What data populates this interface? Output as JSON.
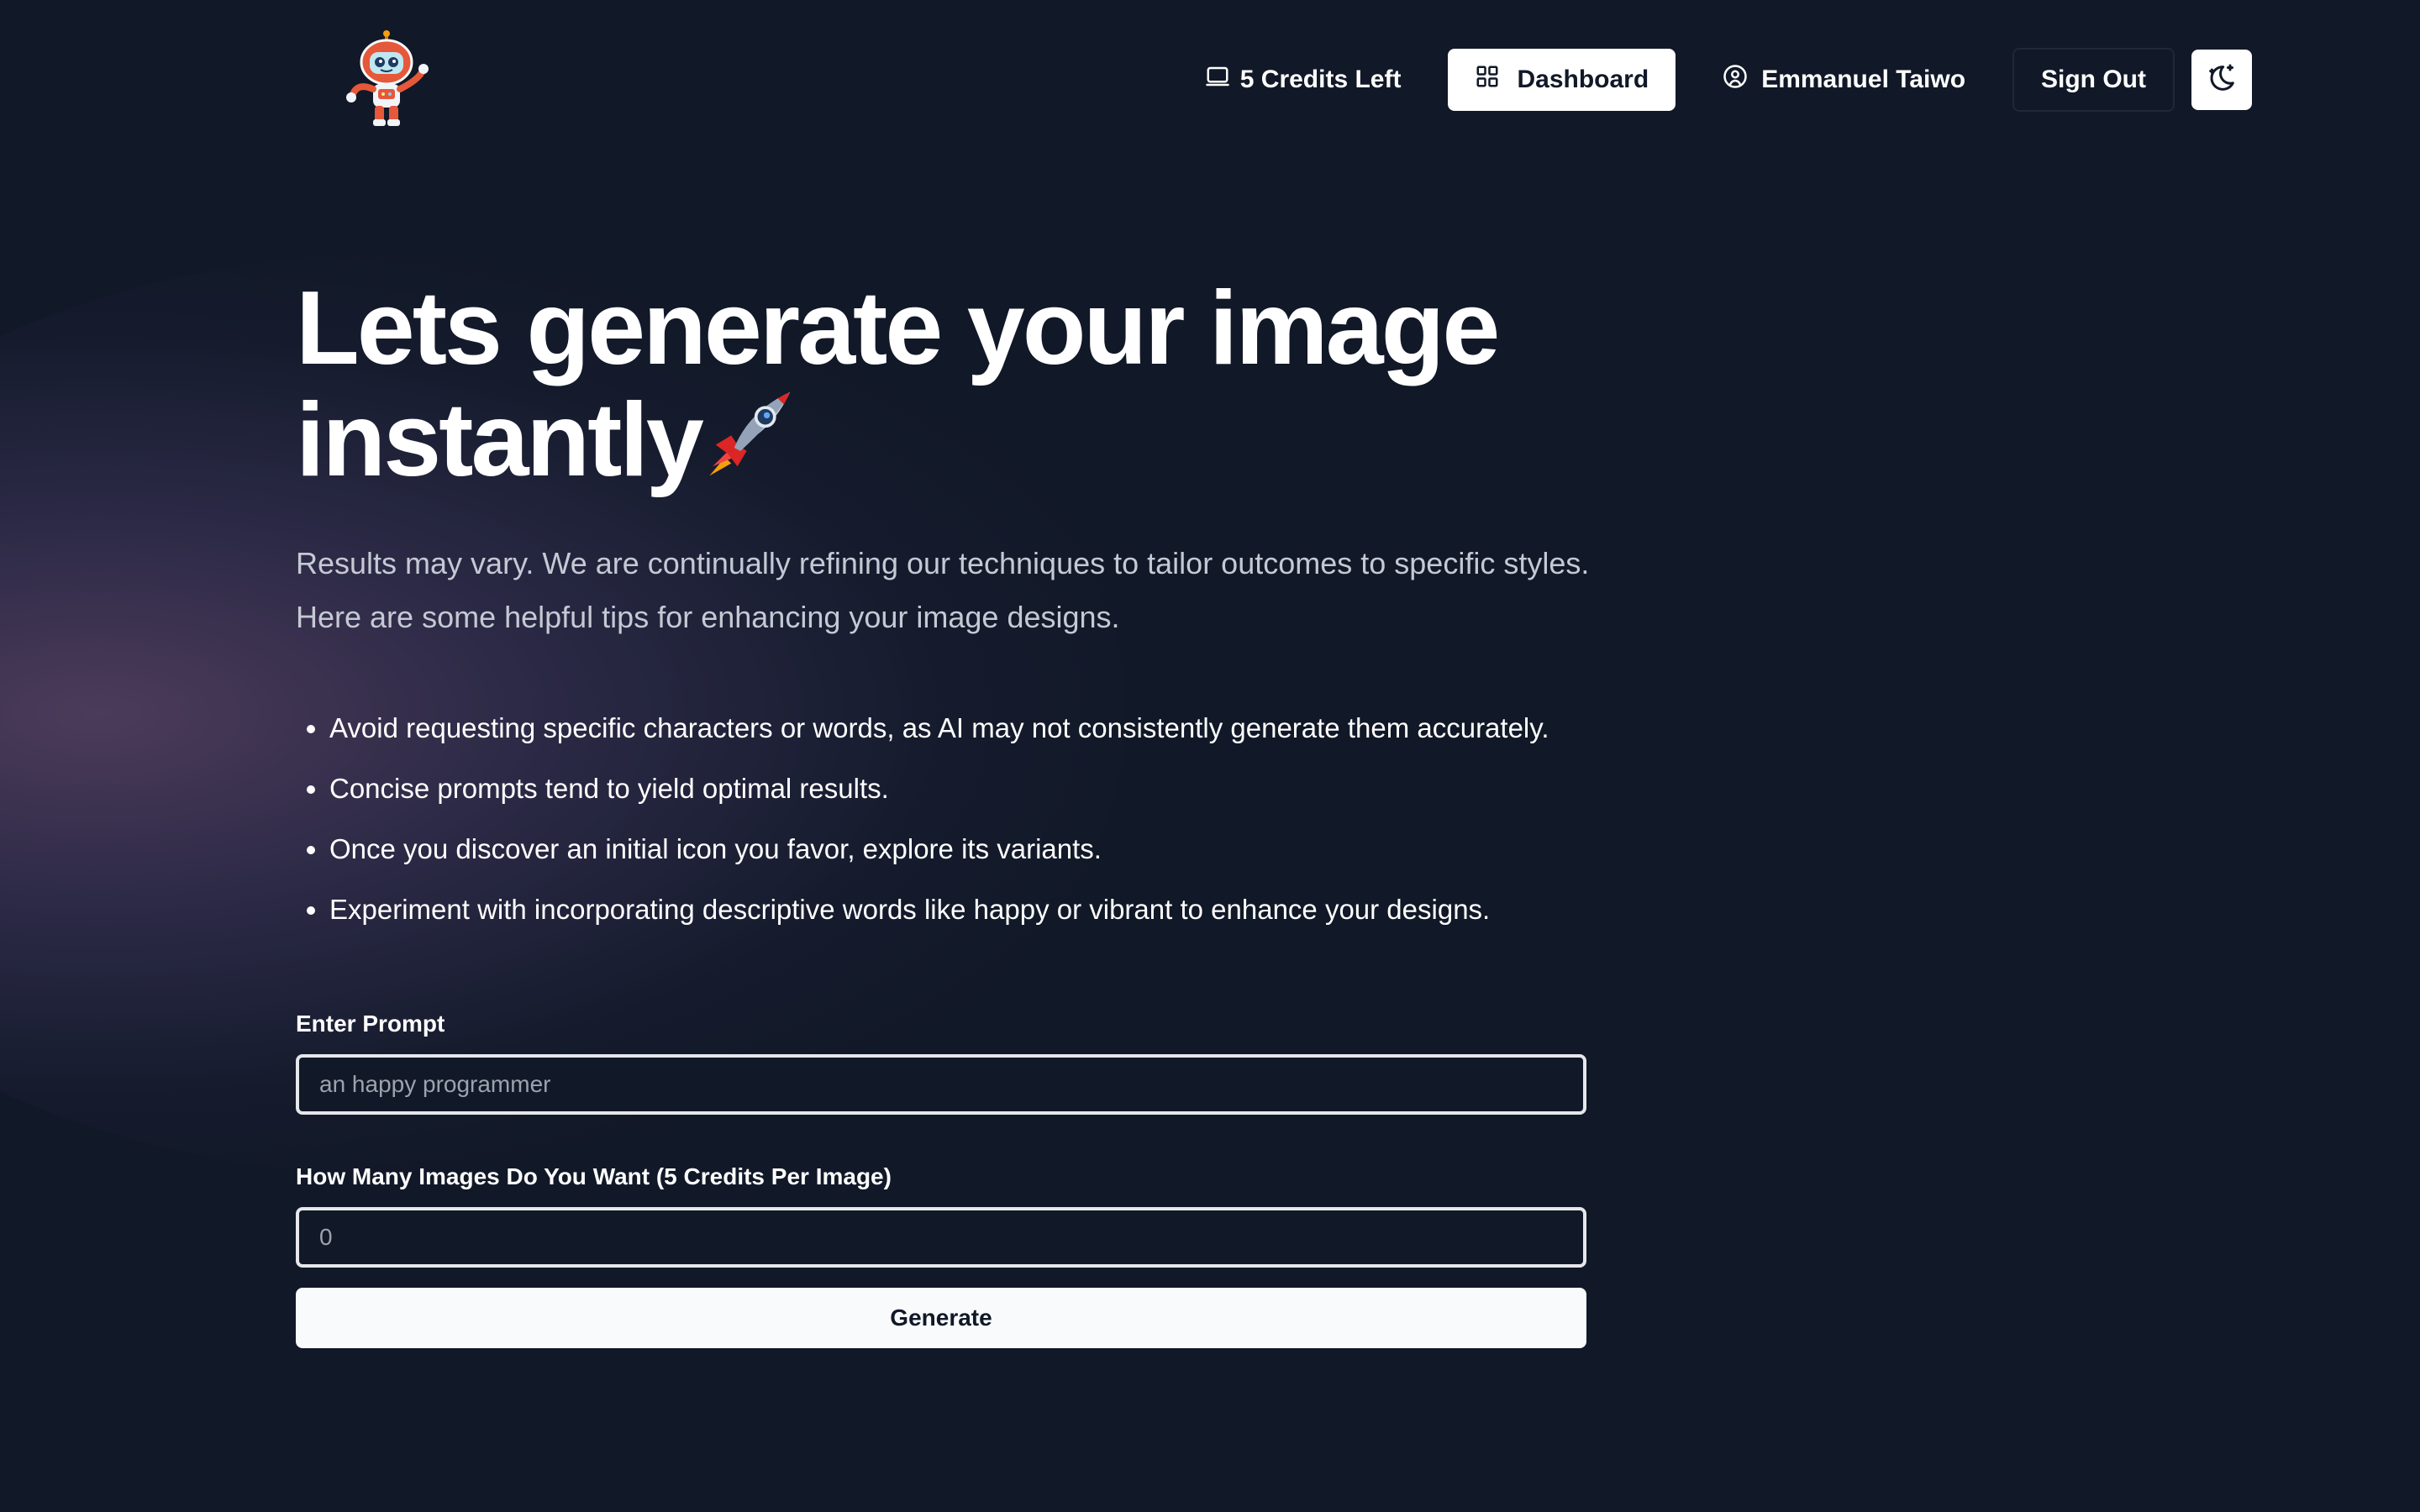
{
  "header": {
    "logo_alt": "robot astronaut logo",
    "credits_label": "5 Credits Left",
    "dashboard_label": "Dashboard",
    "user_name": "Emmanuel Taiwo",
    "signout_label": "Sign Out"
  },
  "hero": {
    "title_line1": "Lets generate your image",
    "title_line2": "instantly",
    "title_emoji": "rocket-icon",
    "subtitle": "Results may vary. We are continually refining our techniques to tailor outcomes to specific styles. Here are some helpful tips for enhancing your image designs."
  },
  "tips": [
    "Avoid requesting specific characters or words, as AI may not consistently generate them accurately.",
    "Concise prompts tend to yield optimal results.",
    "Once you discover an initial icon you favor, explore its variants.",
    "Experiment with incorporating descriptive words like happy or vibrant to enhance your designs."
  ],
  "form": {
    "prompt_label": "Enter Prompt",
    "prompt_placeholder": "an happy programmer",
    "count_label": "How Many Images Do You Want (5 Credits Per Image)",
    "count_placeholder": "0",
    "generate_label": "Generate"
  },
  "colors": {
    "background": "#111827",
    "primary_button": "#ffffff",
    "text": "#ffffff",
    "muted_text": "#c4c9d4",
    "glow": "#7c5884"
  }
}
